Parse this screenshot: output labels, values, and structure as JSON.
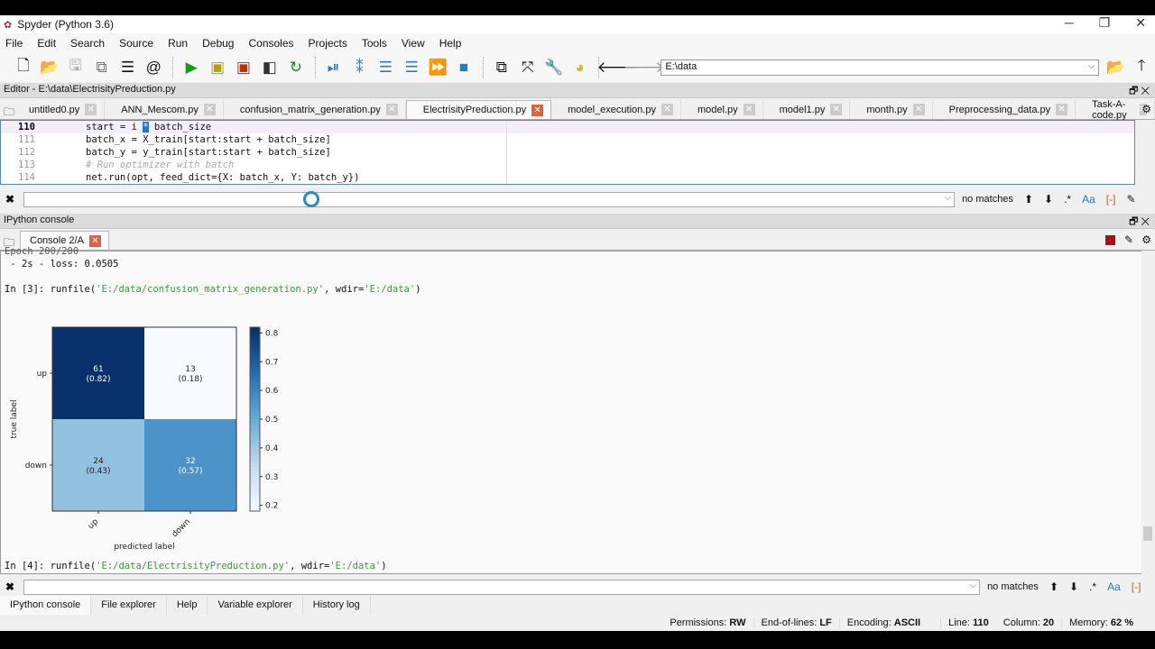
{
  "window": {
    "title": "Spyder (Python 3.6)",
    "controls": [
      "minimize",
      "restore",
      "close"
    ]
  },
  "menu": [
    "File",
    "Edit",
    "Search",
    "Source",
    "Run",
    "Debug",
    "Consoles",
    "Projects",
    "Tools",
    "View",
    "Help"
  ],
  "toolbar": {
    "path": "E:\\data"
  },
  "editor": {
    "header": "Editor - E:\\data\\ElectrisityPreduction.py",
    "tabs": [
      {
        "label": "untitled0.py",
        "active": false
      },
      {
        "label": "ANN_Mescom.py",
        "active": false
      },
      {
        "label": "confusion_matrix_generation.py",
        "active": false
      },
      {
        "label": "ElectrisityPreduction.py",
        "active": true
      },
      {
        "label": "model_execution.py",
        "active": false
      },
      {
        "label": "model.py",
        "active": false
      },
      {
        "label": "model1.py",
        "active": false
      },
      {
        "label": "month.py",
        "active": false
      },
      {
        "label": "Preprocessing_data.py",
        "active": false
      },
      {
        "label": "Task-A-code.py",
        "active": false
      }
    ],
    "lines": [
      {
        "n": "110",
        "pre": "start = i ",
        "sel": "*",
        "post": " batch_size",
        "comment": false
      },
      {
        "n": "111",
        "pre": "batch_x = X_train[start:start + batch_size]",
        "comment": false
      },
      {
        "n": "112",
        "pre": "batch_y = y_train[start:start + batch_size]",
        "comment": false
      },
      {
        "n": "113",
        "pre": "# Run optimizer with batch",
        "comment": true
      },
      {
        "n": "114",
        "pre": "net.run(opt, feed_dict={X: batch_x, Y: batch_y})",
        "comment": false
      }
    ],
    "find": {
      "value": "",
      "status": "no matches"
    }
  },
  "console": {
    "header": "IPython console",
    "tab": "Console 2/A",
    "cut_line": "Epoch 200/200",
    "loss_line": " - 2s - loss: 0.0505",
    "in3": {
      "prompt": "In [3]: ",
      "fn": "runfile(",
      "arg1": "'E:/data/confusion_matrix_generation.py'",
      "mid": ", wdir=",
      "arg2": "'E:/data'",
      "end": ")"
    },
    "in4": {
      "prompt": "In [4]: ",
      "fn": "runfile(",
      "arg1": "'E:/data/ElectrisityPreduction.py'",
      "mid": ", wdir=",
      "arg2": "'E:/data'",
      "end": ")"
    },
    "find": {
      "value": "",
      "status": "no matches"
    }
  },
  "chart_data": {
    "type": "heatmap",
    "xlabel": "predicted label",
    "ylabel": "true label",
    "x_categories": [
      "up",
      "down"
    ],
    "y_categories": [
      "up",
      "down"
    ],
    "counts": [
      [
        61,
        13
      ],
      [
        24,
        32
      ]
    ],
    "normalized": [
      [
        0.82,
        0.18
      ],
      [
        0.43,
        0.57
      ]
    ],
    "cell_labels": [
      [
        "61\n(0.82)",
        "13\n(0.18)"
      ],
      [
        "24\n(0.43)",
        "32\n(0.57)"
      ]
    ],
    "colormap": "Blues",
    "colorbar": {
      "range": [
        0.18,
        0.82
      ],
      "ticks": [
        "0.2",
        "0.3",
        "0.4",
        "0.5",
        "0.6",
        "0.7",
        "0.8"
      ]
    }
  },
  "bottom_tabs": [
    {
      "label": "IPython console",
      "active": true
    },
    {
      "label": "File explorer"
    },
    {
      "label": "Help"
    },
    {
      "label": "Variable explorer"
    },
    {
      "label": "History log"
    }
  ],
  "status": {
    "permissions_label": "Permissions:",
    "permissions": "RW",
    "eol_label": "End-of-lines:",
    "eol": "LF",
    "encoding_label": "Encoding:",
    "encoding": "ASCII",
    "line_label": "Line:",
    "line": "110",
    "column_label": "Column:",
    "column": "20",
    "memory_label": "Memory:",
    "memory": "62 %"
  }
}
